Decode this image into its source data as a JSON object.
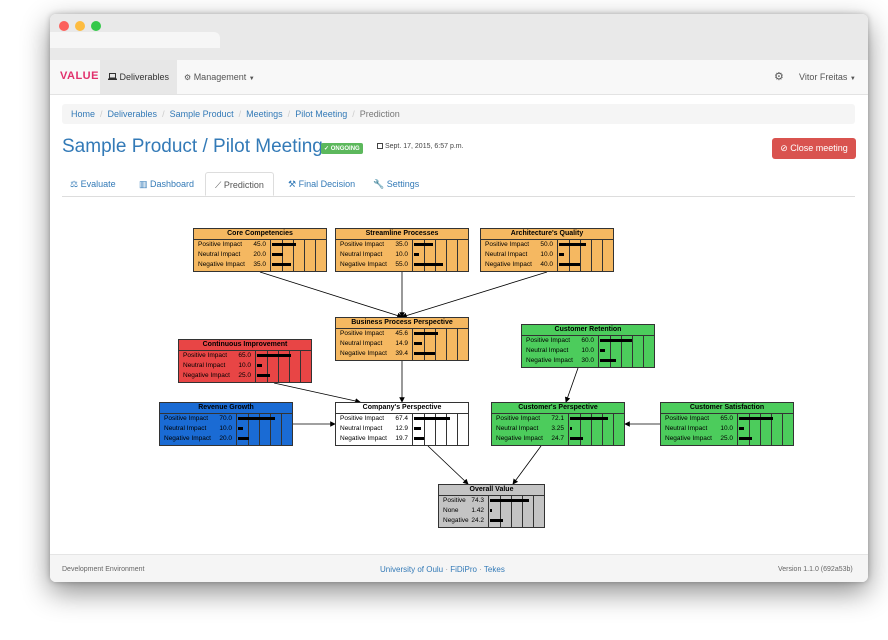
{
  "colors": {
    "brand": "#e1306c",
    "link": "#337ab7",
    "ongoing": "#5cb85c",
    "danger": "#d9534f",
    "node_orange": "#f5b861",
    "node_red": "#e84545",
    "node_blue": "#1a6bd4",
    "node_green": "#4ccc5c",
    "node_white": "#ffffff",
    "node_gray": "#c4c4c4"
  },
  "navbar": {
    "brand": "VALUE",
    "deliverables": "Deliverables",
    "management": "Management",
    "user": "Vitor Freitas"
  },
  "breadcrumb": [
    "Home",
    "Deliverables",
    "Sample Product",
    "Meetings",
    "Pilot Meeting",
    "Prediction"
  ],
  "page": {
    "title": "Sample Product / Pilot Meeting",
    "badge": "ONGOING",
    "date": "Sept. 17, 2015, 6:57 p.m.",
    "close_button": "Close meeting"
  },
  "tabs": [
    "Evaluate",
    "Dashboard",
    "Prediction",
    "Final Decision",
    "Settings"
  ],
  "network": [
    {
      "id": "core",
      "title": "Core Competencies",
      "color": "orange",
      "rows": [
        [
          "Positive Impact",
          "45.0",
          45
        ],
        [
          "Neutral Impact",
          "20.0",
          20
        ],
        [
          "Negative Impact",
          "35.0",
          35
        ]
      ]
    },
    {
      "id": "streamline",
      "title": "Streamline Processes",
      "color": "orange",
      "rows": [
        [
          "Positive Impact",
          "35.0",
          35
        ],
        [
          "Neutral Impact",
          "10.0",
          10
        ],
        [
          "Negative Impact",
          "55.0",
          55
        ]
      ]
    },
    {
      "id": "architecture",
      "title": "Architecture's Quality",
      "color": "orange",
      "rows": [
        [
          "Positive Impact",
          "50.0",
          50
        ],
        [
          "Neutral Impact",
          "10.0",
          10
        ],
        [
          "Negative Impact",
          "40.0",
          40
        ]
      ]
    },
    {
      "id": "bpp",
      "title": "Business Process Perspective",
      "color": "orange",
      "rows": [
        [
          "Positive Impact",
          "45.6",
          45.6
        ],
        [
          "Neutral Impact",
          "14.9",
          14.9
        ],
        [
          "Negative Impact",
          "39.4",
          39.4
        ]
      ]
    },
    {
      "id": "ci",
      "title": "Continuous Improvement",
      "color": "red",
      "rows": [
        [
          "Positive Impact",
          "65.0",
          65
        ],
        [
          "Neutral Impact",
          "10.0",
          10
        ],
        [
          "Negative Impact",
          "25.0",
          25
        ]
      ]
    },
    {
      "id": "retention",
      "title": "Customer Retention",
      "color": "green",
      "rows": [
        [
          "Positive Impact",
          "60.0",
          60
        ],
        [
          "Neutral Impact",
          "10.0",
          10
        ],
        [
          "Negative Impact",
          "30.0",
          30
        ]
      ]
    },
    {
      "id": "revenue",
      "title": "Revenue Growth",
      "color": "blue",
      "rows": [
        [
          "Positive Impact",
          "70.0",
          70
        ],
        [
          "Neutral Impact",
          "10.0",
          10
        ],
        [
          "Negative Impact",
          "20.0",
          20
        ]
      ]
    },
    {
      "id": "company",
      "title": "Company's Perspective",
      "color": "white",
      "rows": [
        [
          "Positive Impact",
          "67.4",
          67.4
        ],
        [
          "Neutral Impact",
          "12.9",
          12.9
        ],
        [
          "Negative Impact",
          "19.7",
          19.7
        ]
      ]
    },
    {
      "id": "customer",
      "title": "Customer's Perspective",
      "color": "green",
      "rows": [
        [
          "Positive Impact",
          "72.1",
          72.1
        ],
        [
          "Neutral Impact",
          "3.25",
          3.25
        ],
        [
          "Negative Impact",
          "24.7",
          24.7
        ]
      ]
    },
    {
      "id": "satisfaction",
      "title": "Customer Satisfaction",
      "color": "green",
      "rows": [
        [
          "Positive Impact",
          "65.0",
          65
        ],
        [
          "Neutral Impact",
          "10.0",
          10
        ],
        [
          "Negative Impact",
          "25.0",
          25
        ]
      ]
    },
    {
      "id": "overall",
      "title": "Overall Value",
      "color": "gray",
      "rows": [
        [
          "Positive",
          "74.3",
          74.3
        ],
        [
          "None",
          "1.42",
          1.42
        ],
        [
          "Negative",
          "24.2",
          24.2
        ]
      ]
    }
  ],
  "footer": {
    "left": "Development Environment",
    "links": [
      "University of Oulu",
      "FiDiPro",
      "Tekes"
    ],
    "version": "Version 1.1.0 (692a53b)"
  }
}
